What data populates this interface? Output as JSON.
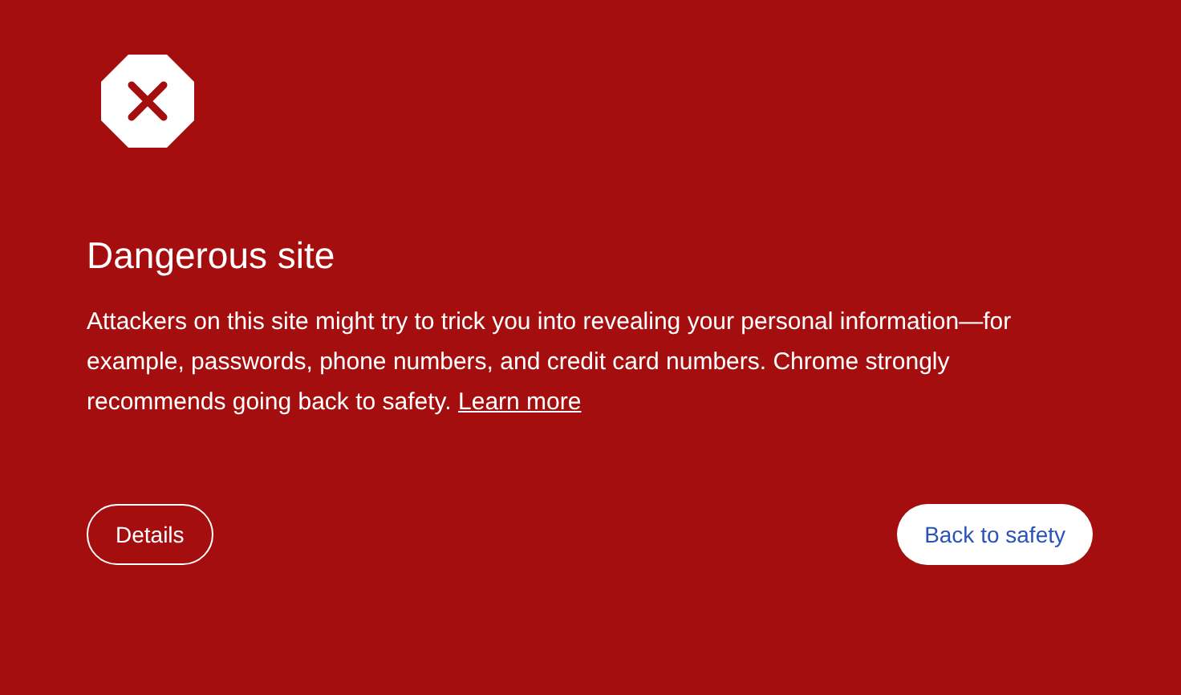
{
  "title": "Dangerous site",
  "message": "Attackers on this site might try to trick you into revealing your personal information—for example, passwords, phone numbers, and credit card numbers. Chrome strongly recommends going back to safety.",
  "learn_more_link": "Learn more",
  "buttons": [
    {
      "label": "Details",
      "kind": "outline"
    },
    {
      "label": "Back to safety",
      "kind": "primary"
    }
  ]
}
